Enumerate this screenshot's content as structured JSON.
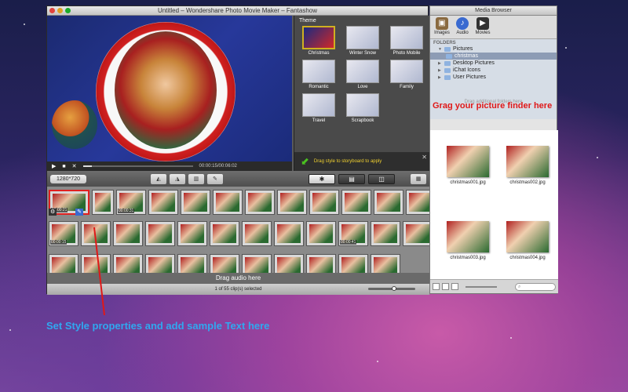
{
  "app": {
    "title": "Untitled – Wondershare Photo Movie Maker – Fantashow",
    "preview": {
      "timecode": "00:00:15/00:06:02"
    },
    "themes": {
      "title": "Theme",
      "items": [
        "Christmas",
        "Winter Snow",
        "Photo Mobile",
        "Romantic",
        "Love",
        "Family",
        "Travel",
        "Scrapbook"
      ],
      "drag_hint": "Drag style to storyboard to apply"
    },
    "toolbar": {
      "resolution": "1280*720"
    },
    "storyboard": {
      "timecodes": [
        "00:00:21",
        "00:00:31",
        "00:00:15",
        "00:00:41"
      ]
    },
    "audio_track": "Drag audio here",
    "status": "1 of 55 clip(s) selected"
  },
  "browser": {
    "title": "Media Browser",
    "tabs": [
      "Images",
      "Audio",
      "Movies"
    ],
    "folders_header": "FOLDERS",
    "folders": [
      "Pictures",
      "christmas",
      "Desktop Pictures",
      "iChat Icons",
      "User Pictures"
    ],
    "hint": "Drag additional folders here",
    "thumbs": [
      "christmas001.jpg",
      "christmas002.jpg",
      "christmas003.jpg",
      "christmas004.jpg"
    ]
  },
  "annotations": {
    "right": "Grag your picture finder here",
    "bottom": "Set Style properties and add sample Text  here"
  }
}
